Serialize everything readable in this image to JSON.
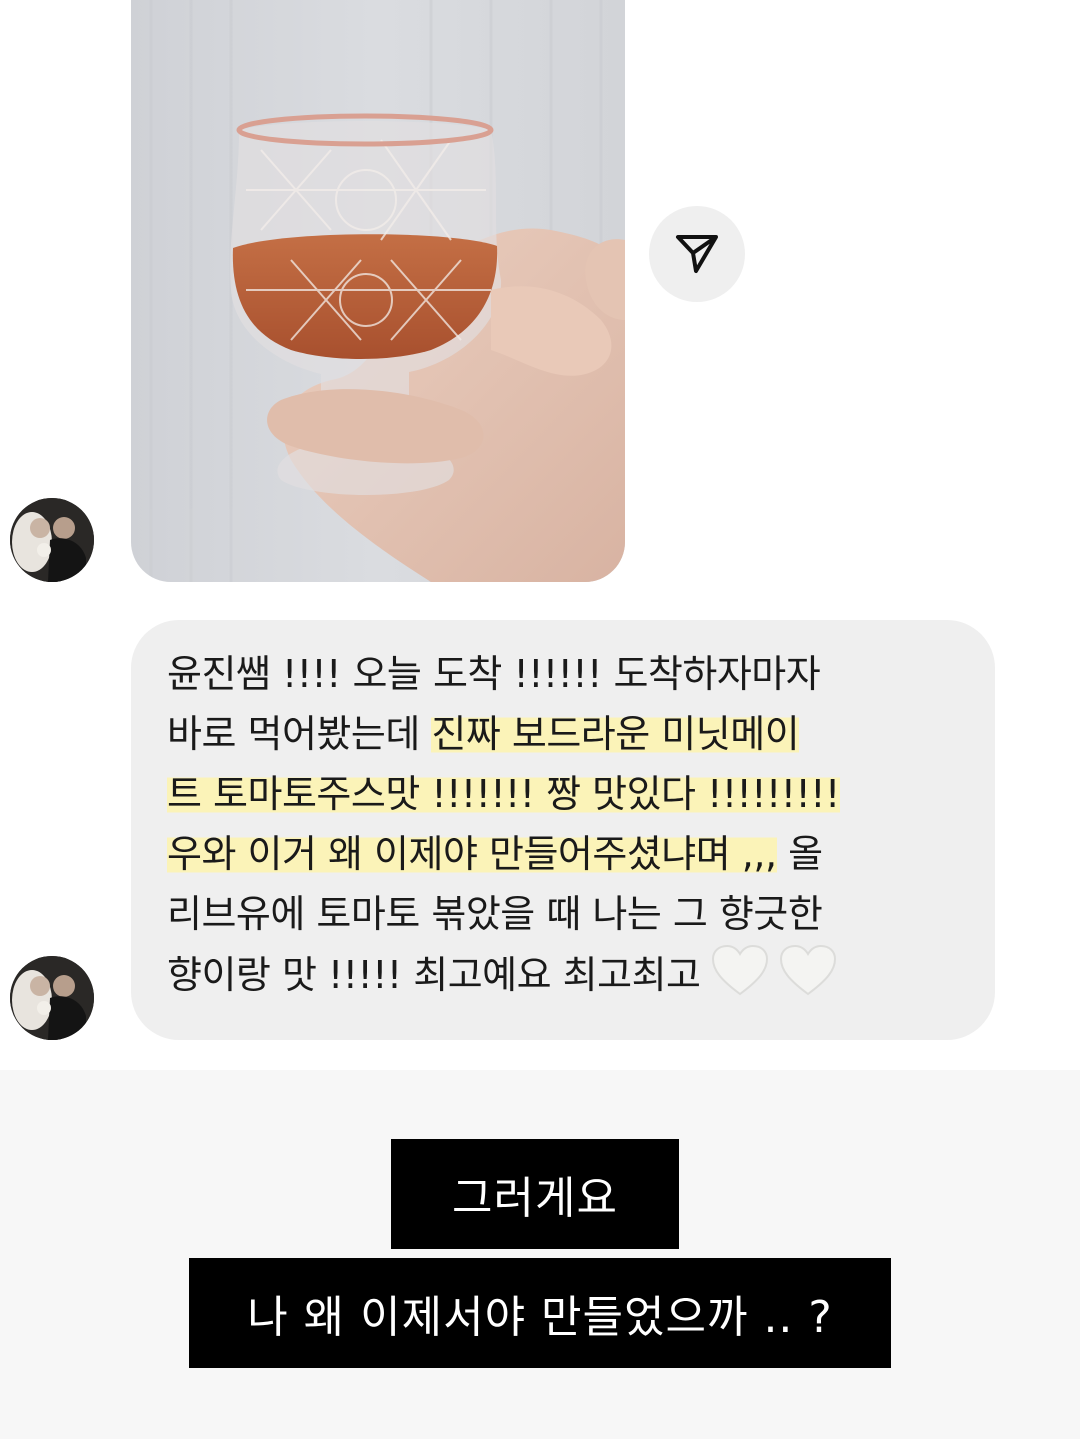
{
  "chat": {
    "photo": {
      "description_icon": "glass-of-tomato-juice-photo"
    },
    "share_icon": "send-icon",
    "avatar_icon": "profile-photo-avatar",
    "message": {
      "lines": [
        {
          "pre": "윤진쌤 !!!! 오늘 도착 !!!!!! 도착하자마자",
          "hl": "",
          "post": ""
        },
        {
          "pre": "바로 먹어봤는데 ",
          "hl": "진짜 보드라운 미닛메이",
          "post": ""
        },
        {
          "pre": "",
          "hl": "트 토마토주스맛 !!!!!!! 짱 맛있다 !!!!!!!!!",
          "post": ""
        },
        {
          "pre": "",
          "hl": "우와 이거 왜 이제야 만들어주셨냐며 ,,,",
          "post": " 올"
        },
        {
          "pre": "리브유에 토마토 볶았을 때 나는 그 향긋한",
          "hl": "",
          "post": ""
        },
        {
          "pre": "향이랑 맛 !!!!! 최고예요 최고최고",
          "hl": "",
          "post": ""
        }
      ],
      "emoji": "white-heart-icon",
      "colors": {
        "bubble": "#efefef",
        "highlight": "#fbf3b8"
      }
    }
  },
  "captions": {
    "line1": "그러게요",
    "line2": "나 왜 이제서야 만들었으까 .. ?"
  },
  "colors": {
    "caption_bg": "#000000",
    "caption_text": "#ffffff",
    "lower_bg": "#f7f7f7"
  }
}
